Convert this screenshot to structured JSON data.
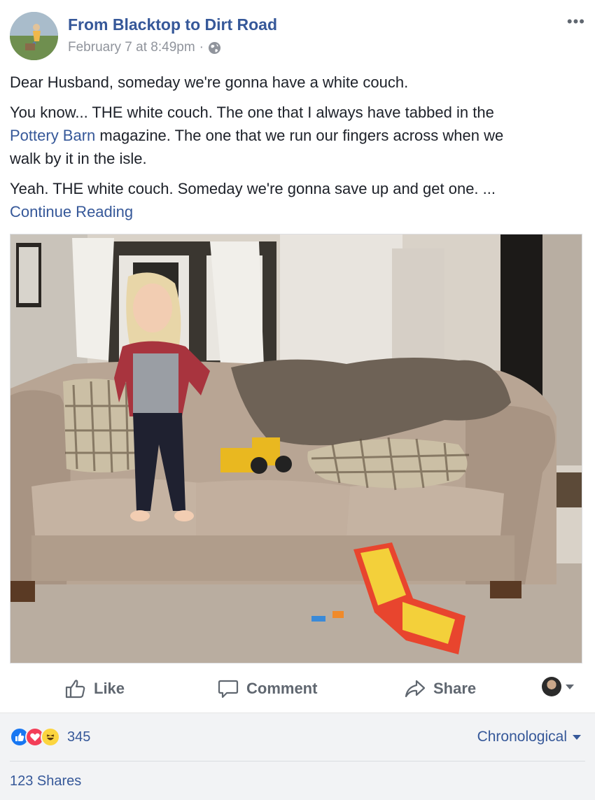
{
  "post": {
    "author": "From Blacktop to Dirt Road",
    "timestamp": "February 7 at 8:49pm",
    "separator": "·",
    "privacy_icon": "globe-icon",
    "more_label": "•••",
    "paragraph1": "Dear Husband, someday we're gonna have a white couch.",
    "paragraph2_a": "You know... THE white couch. The one that I always have tabbed in the",
    "paragraph2_link": "Pottery Barn",
    "paragraph2_b": " magazine. The one that we run our fingers across when we",
    "paragraph2_c": "walk by it in the isle.",
    "paragraph3": "Yeah. THE white couch. Someday we're gonna save up and get one. ...",
    "continue_label": "Continue Reading"
  },
  "actions": {
    "like": "Like",
    "comment": "Comment",
    "share": "Share"
  },
  "footer": {
    "reaction_count": "345",
    "sort_label": "Chronological",
    "shares": "123 Shares"
  },
  "colors": {
    "link": "#365899",
    "like_blue": "#1877f2",
    "love_red": "#f33e58",
    "haha_yellow": "#fcd53f"
  }
}
